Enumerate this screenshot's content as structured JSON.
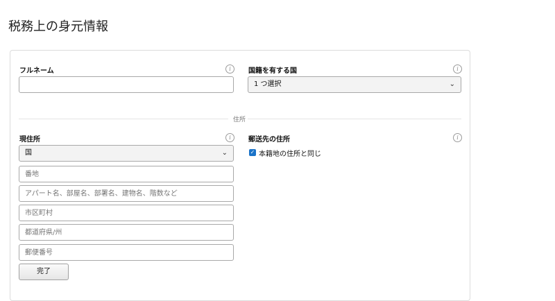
{
  "page": {
    "title": "税務上の身元情報"
  },
  "form": {
    "full_name": {
      "label": "フルネーム",
      "value": ""
    },
    "nationality": {
      "label": "国籍を有する国",
      "selected": "1 つ選択"
    },
    "address_section_label": "住所",
    "current_address": {
      "label": "現住所",
      "country_selected": "国",
      "street_placeholder": "番地",
      "building_placeholder": "アパート名、部屋名、部署名、建物名、階数など",
      "city_placeholder": "市区町村",
      "state_placeholder": "都道府県/州",
      "postal_placeholder": "郵便番号"
    },
    "mailing_address": {
      "label": "郵送先の住所",
      "same_as_label": "本籍地の住所と同じ",
      "same_checked": true
    },
    "done_button": "完了"
  },
  "icons": {
    "info": "info-circle-icon",
    "chevron": "chevron-down-icon",
    "check": "checkmark-icon"
  }
}
